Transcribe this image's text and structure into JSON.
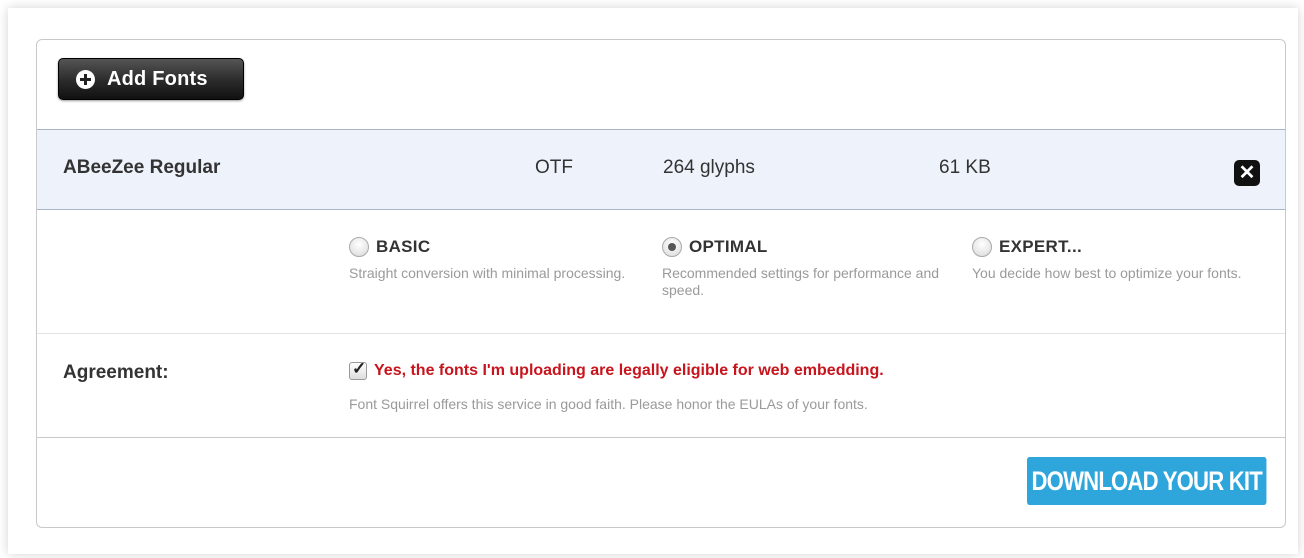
{
  "toolbar": {
    "add_fonts_label": "Add Fonts",
    "add_fonts_icon": "plus-circle-icon"
  },
  "font_list": {
    "items": [
      {
        "name": "ABeeZee Regular",
        "type": "OTF",
        "glyphs": "264 glyphs",
        "size": "61 KB",
        "remove_icon": "close-icon"
      }
    ]
  },
  "optimization": {
    "selected": "OPTIMAL",
    "options": [
      {
        "title": "BASIC",
        "description": "Straight conversion with minimal processing.",
        "checked": false
      },
      {
        "title": "OPTIMAL",
        "description": "Recommended settings for performance and speed.",
        "checked": true
      },
      {
        "title": "EXPERT...",
        "description": "You decide how best to optimize your fonts.",
        "checked": false
      }
    ]
  },
  "agreement": {
    "label": "Agreement:",
    "checkbox_text": "Yes, the fonts I'm uploading are legally eligible for web embedding.",
    "checked": true,
    "note": "Font Squirrel offers this service in good faith. Please honor the EULAs of your fonts."
  },
  "footer": {
    "download_label": "DOWNLOAD YOUR KIT"
  },
  "colors": {
    "accent": "#2ea6dc",
    "warning_text": "#c8141c",
    "row_highlight": "#eef3fb"
  }
}
